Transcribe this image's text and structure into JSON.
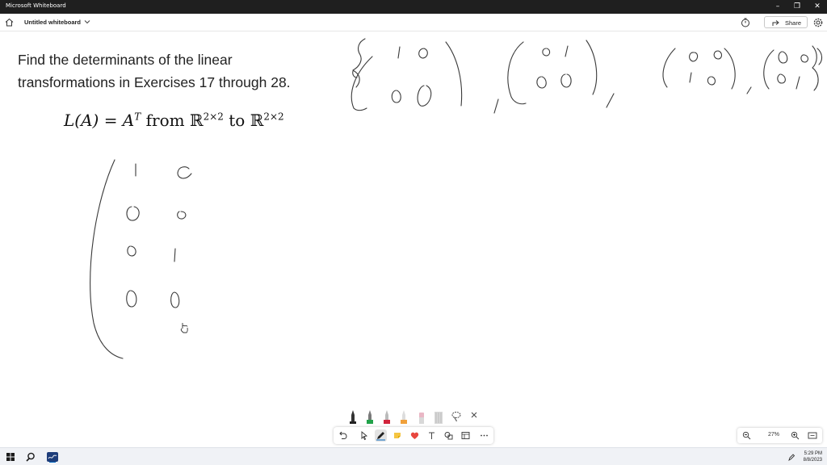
{
  "window": {
    "app_title": "Microsoft Whiteboard",
    "minimize": "–",
    "maximize": "❐",
    "close": "✕"
  },
  "appbar": {
    "board_title": "Untitled whiteboard",
    "share_label": "Share"
  },
  "canvas": {
    "problem_lines": [
      "Find the determinants of the linear",
      "transformations in Exercises 17 through 28."
    ],
    "formula": {
      "lhs": "L(A) = A",
      "sup_t": "T",
      "from": " from ",
      "space": "ℝ",
      "dim": "2×2",
      "to": " to "
    }
  },
  "zoom": {
    "level": "27%"
  },
  "taskbar": {
    "time": "5:29 PM",
    "date": "8/8/2023"
  },
  "colors": {
    "titlebar": "#1f1f1f",
    "ink": "#3a3a3a",
    "accent": "#0067c0"
  }
}
